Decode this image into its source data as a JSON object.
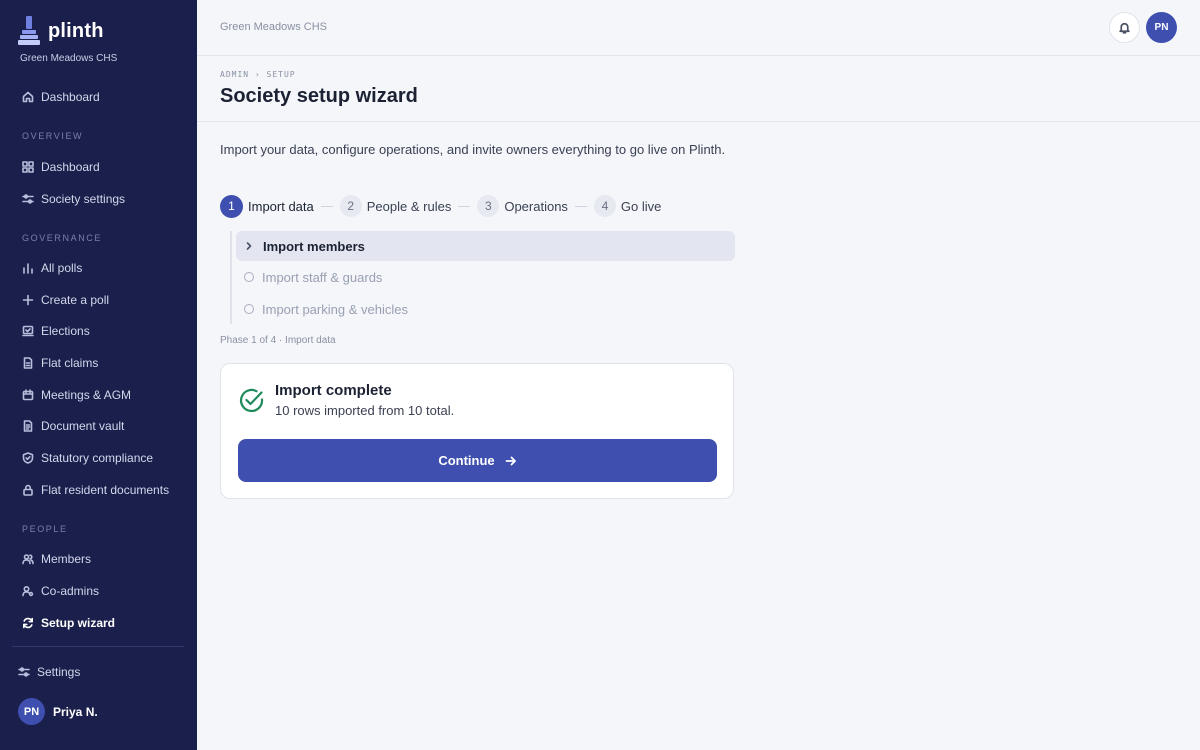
{
  "sidebar": {
    "brand": "plinth",
    "society": "Green Meadows CHS",
    "top_item": "Dashboard",
    "sections": {
      "overview": "OVERVIEW",
      "governance": "GOVERNANCE",
      "people": "PEOPLE"
    },
    "overview_items": [
      "Dashboard",
      "Society settings"
    ],
    "governance_items": [
      "All polls",
      "Create a poll",
      "Elections",
      "Flat claims",
      "Meetings & AGM",
      "Document vault",
      "Statutory compliance",
      "Flat resident documents"
    ],
    "people_items": [
      "Members",
      "Co-admins",
      "Setup wizard"
    ],
    "settings": "Settings",
    "user": {
      "initials": "PN",
      "name": "Priya N."
    }
  },
  "topbar": {
    "society": "Green Meadows CHS",
    "avatar_initials": "PN"
  },
  "header": {
    "path": "ADMIN › SETUP",
    "title": "Society setup wizard"
  },
  "intro": "Import your data, configure operations, and invite owners everything to go live on Plinth.",
  "steps": [
    {
      "num": "1",
      "label": "Import data"
    },
    {
      "num": "2",
      "label": "People & rules"
    },
    {
      "num": "3",
      "label": "Operations"
    },
    {
      "num": "4",
      "label": "Go live"
    }
  ],
  "subitems": [
    "Import members",
    "Import staff & guards",
    "Import parking & vehicles"
  ],
  "phase": "Phase 1 of 4 · Import data",
  "card": {
    "title": "Import complete",
    "subtitle": "10 rows imported from 10 total.",
    "button": "Continue"
  },
  "colors": {
    "sidebar_bg": "#1b1f4b",
    "accent": "#3f4fb0",
    "success": "#1f8a5b"
  }
}
